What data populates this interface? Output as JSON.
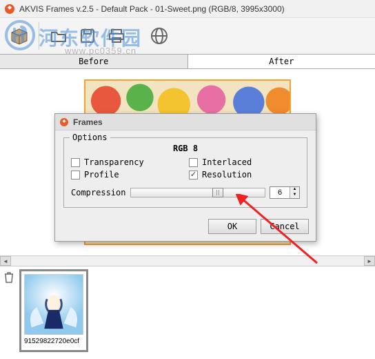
{
  "window": {
    "title": "AKVIS Frames v.2.5 - Default Pack - 01-Sweet.png (RGB/8, 3995x3000)"
  },
  "watermark": {
    "text": "河东软件园",
    "url": "www.pc0359.cn"
  },
  "tabs": {
    "before": "Before",
    "after": "After"
  },
  "dialog": {
    "title": "Frames",
    "fieldset_legend": "Options",
    "format": "RGB 8",
    "options": {
      "transparency": {
        "label": "Transparency",
        "checked": false
      },
      "interlaced": {
        "label": "Interlaced",
        "checked": false
      },
      "profile": {
        "label": "Profile",
        "checked": false
      },
      "resolution": {
        "label": "Resolution",
        "checked": true
      }
    },
    "compression": {
      "label": "Compression",
      "value": "6",
      "min": 0,
      "max": 9
    },
    "buttons": {
      "ok": "OK",
      "cancel": "Cancel"
    }
  },
  "thumbnail": {
    "filename": "91529822720e0cf"
  }
}
